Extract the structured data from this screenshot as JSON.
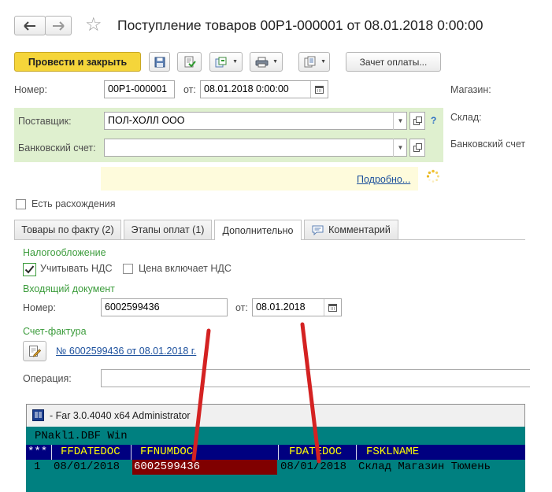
{
  "header": {
    "title": "Поступление товаров 00Р1-000001 от 08.01.2018 0:00:00",
    "back_label": "🡐",
    "forward_label": "🡒",
    "star_label": "☆"
  },
  "toolbar": {
    "post_close_label": "Провести и закрыть",
    "payment_offset_label": "Зачет оплаты..."
  },
  "form": {
    "number_label": "Номер:",
    "number_value": "00Р1-000001",
    "from_label": "от:",
    "date_value": "08.01.2018  0:00:00",
    "store_label": "Магазин:",
    "supplier_label": "Поставщик:",
    "supplier_value": "ПОЛ-ХОЛЛ ООО",
    "question_label": "?",
    "warehouse_label": "Склад:",
    "bank_account_label": "Банковский счет:",
    "bank_account_value": "",
    "bank_account_right_label": "Банковский счет",
    "details_link": "Подробно...",
    "discrepancy_label": "Есть расхождения"
  },
  "tabs": [
    {
      "label": "Товары по факту (2)"
    },
    {
      "label": "Этапы оплат (1)"
    },
    {
      "label": "Дополнительно"
    },
    {
      "label": "Комментарий"
    }
  ],
  "additional": {
    "taxation_label": "Налогообложение",
    "vat_label": "Учитывать НДС",
    "vat_checked": true,
    "price_incl_vat_label": "Цена включает НДС",
    "price_incl_vat_checked": false,
    "incoming_doc_label": "Входящий документ",
    "inc_number_label": "Номер:",
    "inc_number_value": "6002599436",
    "inc_from_label": "от:",
    "inc_date_value": "08.01.2018",
    "invoice_label": "Счет-фактура",
    "invoice_link": "№ 6002599436 от 08.01.2018 г.",
    "operation_label": "Операция:",
    "operation_value": ""
  },
  "far": {
    "window_title": "- Far 3.0.4040 x64 Administrator",
    "file_line": "PNakl1.DBF Win",
    "headers": [
      "***",
      "FFDATEDOC",
      "FFNUMDOC",
      "FDATEDOC",
      "FSKLNAME"
    ],
    "row": [
      "1",
      "08/01/2018",
      "6002599436",
      "08/01/2018",
      "Склад Магазин Тюмень"
    ]
  },
  "colors": {
    "post_button": "#f5d53a",
    "supplier_panel": "#dff0cf",
    "hint_panel": "#fefbdc",
    "link": "#1b4f9c",
    "far_teal": "#008080",
    "far_navy": "#000080",
    "far_highlight": "#800000",
    "annotation_red": "#d42222"
  }
}
